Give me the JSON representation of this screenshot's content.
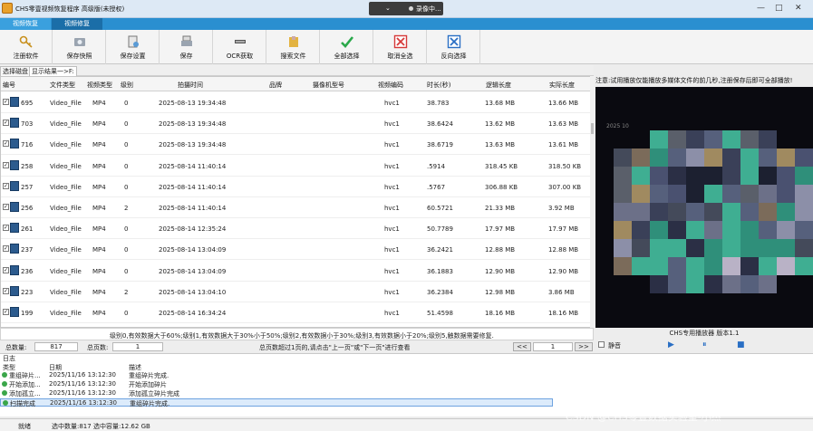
{
  "titlebar": {
    "title": "CHS零壹视频恢复程序 高级版(未授权)",
    "recording": {
      "chevron": "⌄",
      "label": "录像中..."
    },
    "controls": [
      "—",
      "□",
      "✕"
    ]
  },
  "tabs": [
    {
      "label": "视频恢复"
    },
    {
      "label": "视频修复"
    }
  ],
  "toolbar": {
    "register": "注册软件",
    "save_fast": "保存快照",
    "save_settings": "保存设置",
    "save": "保存",
    "ocr": "OCR获取",
    "search_file": "搜索文件",
    "select_all": "全部选择",
    "cancel_all": "取消全选",
    "invert": "反向选择"
  },
  "subtabs": {
    "disk": "选择磁盘",
    "results": "显示结果一>F:"
  },
  "table": {
    "headers": [
      "编号",
      "文件类型",
      "视频类型",
      "级别",
      "拍摄时间",
      "品牌",
      "摄像机型号",
      "视频编码",
      "时长(秒)",
      "逻辑长度",
      "实际长度"
    ],
    "rows": [
      {
        "check": "✓",
        "id": "695",
        "type": "Video_File",
        "vtype": "MP4",
        "level": "0",
        "time": "2025-08-13 19:34:48",
        "brand": "",
        "model": "",
        "codec": "hvc1",
        "duration": "38.783",
        "logical": "13.68 MB",
        "actual": "13.66 MB"
      },
      {
        "check": "✓",
        "id": "703",
        "type": "Video_File",
        "vtype": "MP4",
        "level": "0",
        "time": "2025-08-13 19:34:48",
        "brand": "",
        "model": "",
        "codec": "hvc1",
        "duration": "38.6424",
        "logical": "13.62 MB",
        "actual": "13.63 MB"
      },
      {
        "check": "✓",
        "id": "716",
        "type": "Video_File",
        "vtype": "MP4",
        "level": "0",
        "time": "2025-08-13 19:34:48",
        "brand": "",
        "model": "",
        "codec": "hvc1",
        "duration": "38.6719",
        "logical": "13.63 MB",
        "actual": "13.61 MB"
      },
      {
        "check": "✓",
        "id": "258",
        "type": "Video_File",
        "vtype": "MP4",
        "level": "0",
        "time": "2025-08-14 11:40:14",
        "brand": "",
        "model": "",
        "codec": "hvc1",
        "duration": ".5914",
        "logical": "318.45 KB",
        "actual": "318.50 KB"
      },
      {
        "check": "✓",
        "id": "257",
        "type": "Video_File",
        "vtype": "MP4",
        "level": "0",
        "time": "2025-08-14 11:40:14",
        "brand": "",
        "model": "",
        "codec": "hvc1",
        "duration": ".5767",
        "logical": "306.88 KB",
        "actual": "307.00 KB"
      },
      {
        "check": "✓",
        "id": "256",
        "type": "Video_File",
        "vtype": "MP4",
        "level": "2",
        "time": "2025-08-14 11:40:14",
        "brand": "",
        "model": "",
        "codec": "hvc1",
        "duration": "60.5721",
        "logical": "21.33 MB",
        "actual": "3.92 MB"
      },
      {
        "check": "✓",
        "id": "261",
        "type": "Video_File",
        "vtype": "MP4",
        "level": "0",
        "time": "2025-08-14 12:35:24",
        "brand": "",
        "model": "",
        "codec": "hvc1",
        "duration": "50.7789",
        "logical": "17.97 MB",
        "actual": "17.97 MB"
      },
      {
        "check": "✓",
        "id": "237",
        "type": "Video_File",
        "vtype": "MP4",
        "level": "0",
        "time": "2025-08-14 13:04:09",
        "brand": "",
        "model": "",
        "codec": "hvc1",
        "duration": "36.2421",
        "logical": "12.88 MB",
        "actual": "12.88 MB"
      },
      {
        "check": "✓",
        "id": "236",
        "type": "Video_File",
        "vtype": "MP4",
        "level": "0",
        "time": "2025-08-14 13:04:09",
        "brand": "",
        "model": "",
        "codec": "hvc1",
        "duration": "36.1883",
        "logical": "12.90 MB",
        "actual": "12.90 MB"
      },
      {
        "check": "✓",
        "id": "223",
        "type": "Video_File",
        "vtype": "MP4",
        "level": "2",
        "time": "2025-08-14 13:04:10",
        "brand": "",
        "model": "",
        "codec": "hvc1",
        "duration": "36.2384",
        "logical": "12.98 MB",
        "actual": "3.86 MB"
      },
      {
        "check": "✓",
        "id": "199",
        "type": "Video_File",
        "vtype": "MP4",
        "level": "0",
        "time": "2025-08-14 16:34:24",
        "brand": "",
        "model": "",
        "codec": "hvc1",
        "duration": "51.4598",
        "logical": "18.16 MB",
        "actual": "18.16 MB"
      },
      {
        "check": "✓",
        "id": "198",
        "type": "Video_File",
        "vtype": "MP4",
        "level": "0",
        "time": "2025-08-14 16:34:24",
        "brand": "",
        "model": "",
        "codec": "hvc1",
        "duration": "51.4318",
        "logical": "18.21 MB",
        "actual": "18.21 MB"
      },
      {
        "check": "✓",
        "id": "196",
        "type": "Video_File",
        "vtype": "MP4",
        "level": "0",
        "time": "2025-08-14 16:34:24",
        "brand": "",
        "model": "",
        "codec": "hvc1",
        "duration": "51.3806",
        "logical": "18.25 MB",
        "actual": "18.25 MB"
      }
    ]
  },
  "legend": "级别0,有效数据大于60%;级别1,有效数据大于30%小于50%;级别2,有效数据小于30%;级别3,有效数据小于20%;级别5,触数据需要修复.",
  "pager": {
    "total_label": "总数量:",
    "total": "817",
    "pages_label": "总页数:",
    "pages": "1",
    "hint": "总页数超过1页的,请点击\"上一页\"或\"下一页\"进行查看",
    "prev": "<<",
    "page": "1",
    "next": ">>"
  },
  "player": {
    "notice": "注意:试用播放仅能播放多媒体文件的前几秒,注册保存后即可全部播放!",
    "timestamp": "2025 10 ",
    "title": "CHS专用播放器 版本1.1",
    "mute": "静音",
    "play_icon": "▶",
    "pause_icon": "⏸",
    "stop_icon": "■"
  },
  "log": {
    "title": "日志",
    "headers": [
      "类型",
      "日期",
      "描述"
    ],
    "rows": [
      {
        "type": "重组碎片...",
        "date": "2025/11/16 13:12:30",
        "desc": "重组碎片完成."
      },
      {
        "type": "开始添加...",
        "date": "2025/11/16 13:12:30",
        "desc": "开始添加碎片"
      },
      {
        "type": "添加孤立...",
        "date": "2025/11/16 13:12:30",
        "desc": "添加孤立碎片完成"
      },
      {
        "type": "扫描完成",
        "date": "2025/11/16 13:12:30",
        "desc": "重组碎片完成."
      }
    ]
  },
  "status": {
    "ready": "就绪",
    "summary": "选中数量:817 选中容量:12.62 GB"
  },
  "watermark": "CSDN @CHS零壹数据实验室-小杰",
  "colors": {
    "tab_bar": "#2a8fd0",
    "accent_green": "#2aa84a",
    "accent_red": "#d63a3a",
    "accent_blue": "#2a6fc4"
  }
}
